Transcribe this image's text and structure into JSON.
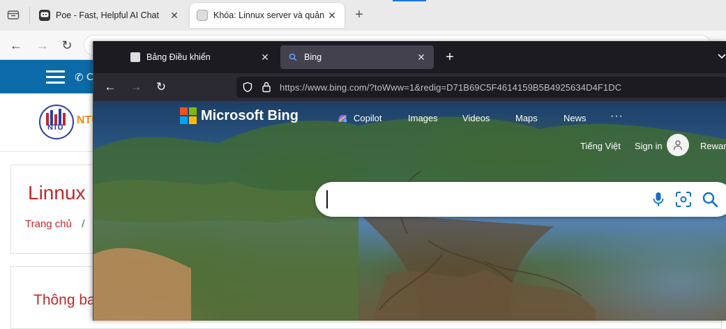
{
  "back_browser": {
    "tabs": [
      {
        "label": "Poe - Fast, Helpful AI Chat",
        "close": "✕"
      },
      {
        "label": "Khóa: Linnux server và quản trị",
        "close": "✕"
      }
    ],
    "new_tab": "+"
  },
  "back_page": {
    "logo_small_text": "NTU",
    "logo_side_text": "NTU",
    "menu_phone_text": "C",
    "course_title": "Linnux",
    "breadcrumb_home": "Trang chủ",
    "breadcrumb_sep": "/",
    "section_title": "Thông ba",
    "colors": {
      "bar": "#0b6aa8",
      "title": "#c0292b"
    }
  },
  "front_browser": {
    "tabs": [
      {
        "label": "Bảng Điều khiển",
        "close": "✕"
      },
      {
        "label": "Bing",
        "close": "✕"
      }
    ],
    "new_tab": "+",
    "url": "https://www.bing.com/?toWww=1&redig=D71B69C5F4614159B5B4925634D4F1DC"
  },
  "bing": {
    "brand": "Microsoft Bing",
    "nav": [
      "Copilot",
      "Images",
      "Videos",
      "Maps",
      "News"
    ],
    "more": "···",
    "language": "Tiếng Việt",
    "sign_in": "Sign in",
    "rewards": "Rewar",
    "search_value": "",
    "colors": {
      "accent": "#0b70cf",
      "mic": "#1170c7"
    }
  }
}
